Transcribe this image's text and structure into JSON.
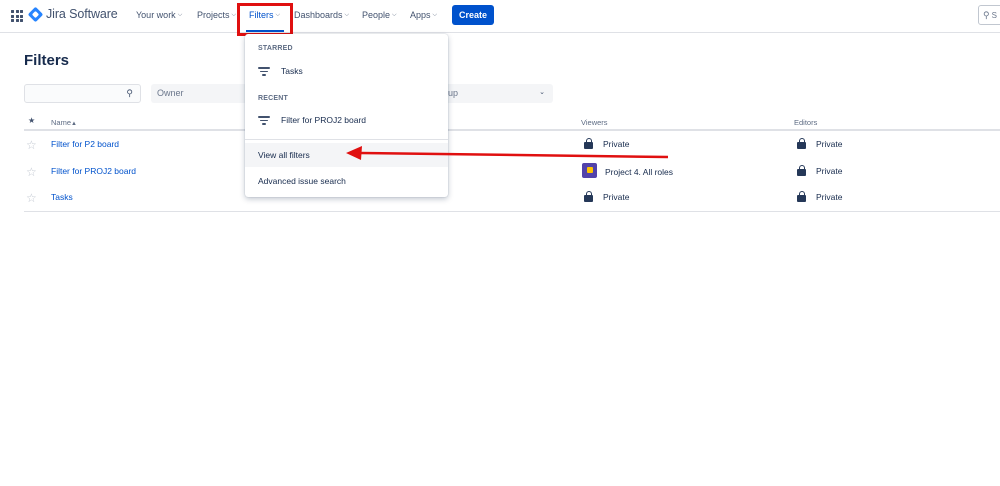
{
  "app": {
    "name": "Jira Software"
  },
  "nav": {
    "items": [
      {
        "label": "Your work"
      },
      {
        "label": "Projects"
      },
      {
        "label": "Filters"
      },
      {
        "label": "Dashboards"
      },
      {
        "label": "People"
      },
      {
        "label": "Apps"
      }
    ],
    "create_label": "Create",
    "search_placeholder": "S"
  },
  "page": {
    "title": "Filters",
    "search_placeholder": "",
    "owner_placeholder": "Owner",
    "group_placeholder": "up"
  },
  "table": {
    "headers": {
      "star": "★",
      "name": "Name",
      "viewers": "Viewers",
      "editors": "Editors"
    },
    "rows": [
      {
        "name": "Filter for P2 board",
        "viewer": "Private",
        "editor": "Private"
      },
      {
        "name": "Filter for PROJ2 board",
        "viewer": "Project 4. All roles",
        "editor": "Private"
      },
      {
        "name": "Tasks",
        "viewer": "Private",
        "editor": "Private"
      }
    ]
  },
  "dropdown": {
    "starred_heading": "STARRED",
    "starred_items": [
      "Tasks"
    ],
    "recent_heading": "RECENT",
    "recent_items": [
      "Filter for PROJ2 board"
    ],
    "view_all_label": "View all filters",
    "advanced_label": "Advanced issue search"
  },
  "colors": {
    "brand": "#0052cc",
    "annotation": "#e01010"
  }
}
